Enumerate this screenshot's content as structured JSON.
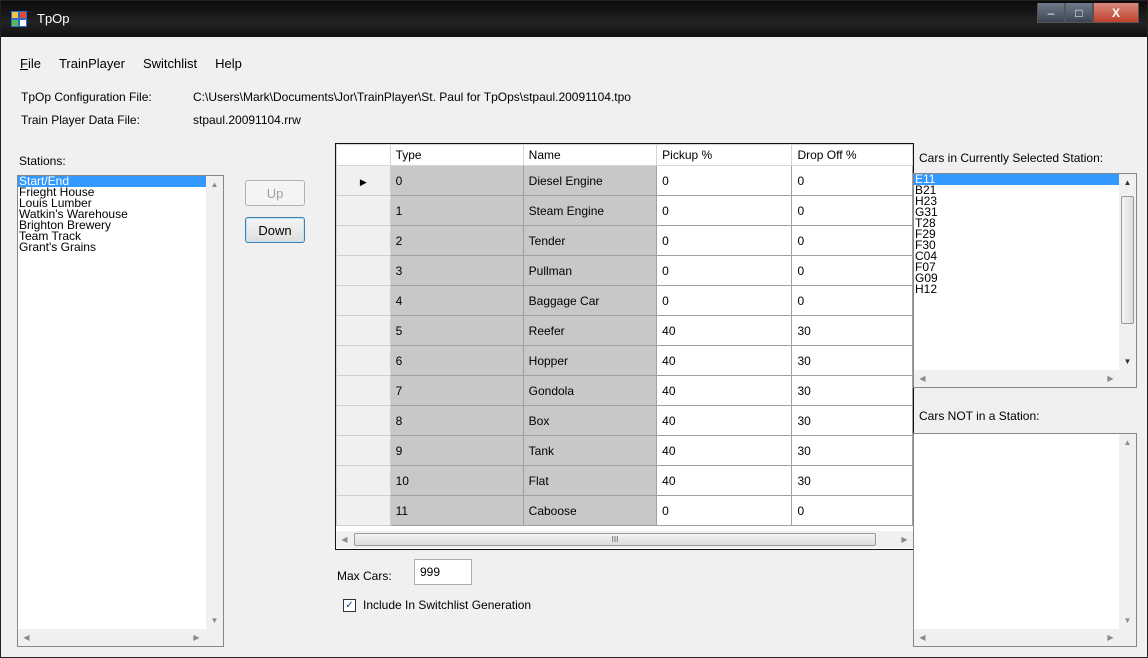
{
  "window": {
    "title": "TpOp",
    "icon": "app-icon",
    "buttons": {
      "minimize": "–",
      "maximize": "□",
      "close": "X"
    }
  },
  "menu": [
    {
      "label": "File",
      "u": "F",
      "rest": "ile"
    },
    {
      "label": "TrainPlayer"
    },
    {
      "label": "Switchlist"
    },
    {
      "label": "Help"
    }
  ],
  "config": {
    "config_label": "TpOp Configuration File:",
    "config_value": "C:\\Users\\Mark\\Documents\\Jor\\TrainPlayer\\St. Paul for TpOps\\stpaul.20091104.tpo",
    "data_label": "Train Player Data File:",
    "data_value": "stpaul.20091104.rrw"
  },
  "stations": {
    "label": "Stations:",
    "items": [
      "Start/End",
      "Frieght House",
      "Louis Lumber",
      "Watkin's Warehouse",
      "Brighton Brewery",
      "Team Track",
      "Grant's Grains"
    ],
    "selected_index": 0
  },
  "order_buttons": {
    "up": "Up",
    "down": "Down"
  },
  "grid": {
    "columns": [
      "Type",
      "Name",
      "Pickup %",
      "Drop Off %"
    ],
    "rows": [
      {
        "type": "0",
        "name": "Diesel Engine",
        "pickup": "0",
        "dropoff": "0"
      },
      {
        "type": "1",
        "name": "Steam Engine",
        "pickup": "0",
        "dropoff": "0"
      },
      {
        "type": "2",
        "name": "Tender",
        "pickup": "0",
        "dropoff": "0"
      },
      {
        "type": "3",
        "name": "Pullman",
        "pickup": "0",
        "dropoff": "0"
      },
      {
        "type": "4",
        "name": "Baggage Car",
        "pickup": "0",
        "dropoff": "0"
      },
      {
        "type": "5",
        "name": "Reefer",
        "pickup": "40",
        "dropoff": "30"
      },
      {
        "type": "6",
        "name": "Hopper",
        "pickup": "40",
        "dropoff": "30"
      },
      {
        "type": "7",
        "name": "Gondola",
        "pickup": "40",
        "dropoff": "30"
      },
      {
        "type": "8",
        "name": "Box",
        "pickup": "40",
        "dropoff": "30"
      },
      {
        "type": "9",
        "name": "Tank",
        "pickup": "40",
        "dropoff": "30"
      },
      {
        "type": "10",
        "name": "Flat",
        "pickup": "40",
        "dropoff": "30"
      },
      {
        "type": "11",
        "name": "Caboose",
        "pickup": "0",
        "dropoff": "0"
      }
    ],
    "current_row_marker": "▶",
    "scroll_grip": "III"
  },
  "max_cars": {
    "label": "Max Cars:",
    "value": "999"
  },
  "include": {
    "label": "Include In Switchlist Generation",
    "checked": true,
    "check_glyph": "✓"
  },
  "cars_in_station": {
    "label": "Cars in Currently Selected Station:",
    "items": [
      "E11",
      "B21",
      "H23",
      "G31",
      "T28",
      "F29",
      "F30",
      "C04",
      "F07",
      "G09",
      "H12"
    ],
    "selected_index": 0
  },
  "cars_not_in_station": {
    "label": "Cars NOT in a Station:",
    "items": []
  },
  "colors": {
    "selection": "#3399ff",
    "readonly_cell": "#c8c8c8",
    "window_bg": "#f0f0f0"
  }
}
